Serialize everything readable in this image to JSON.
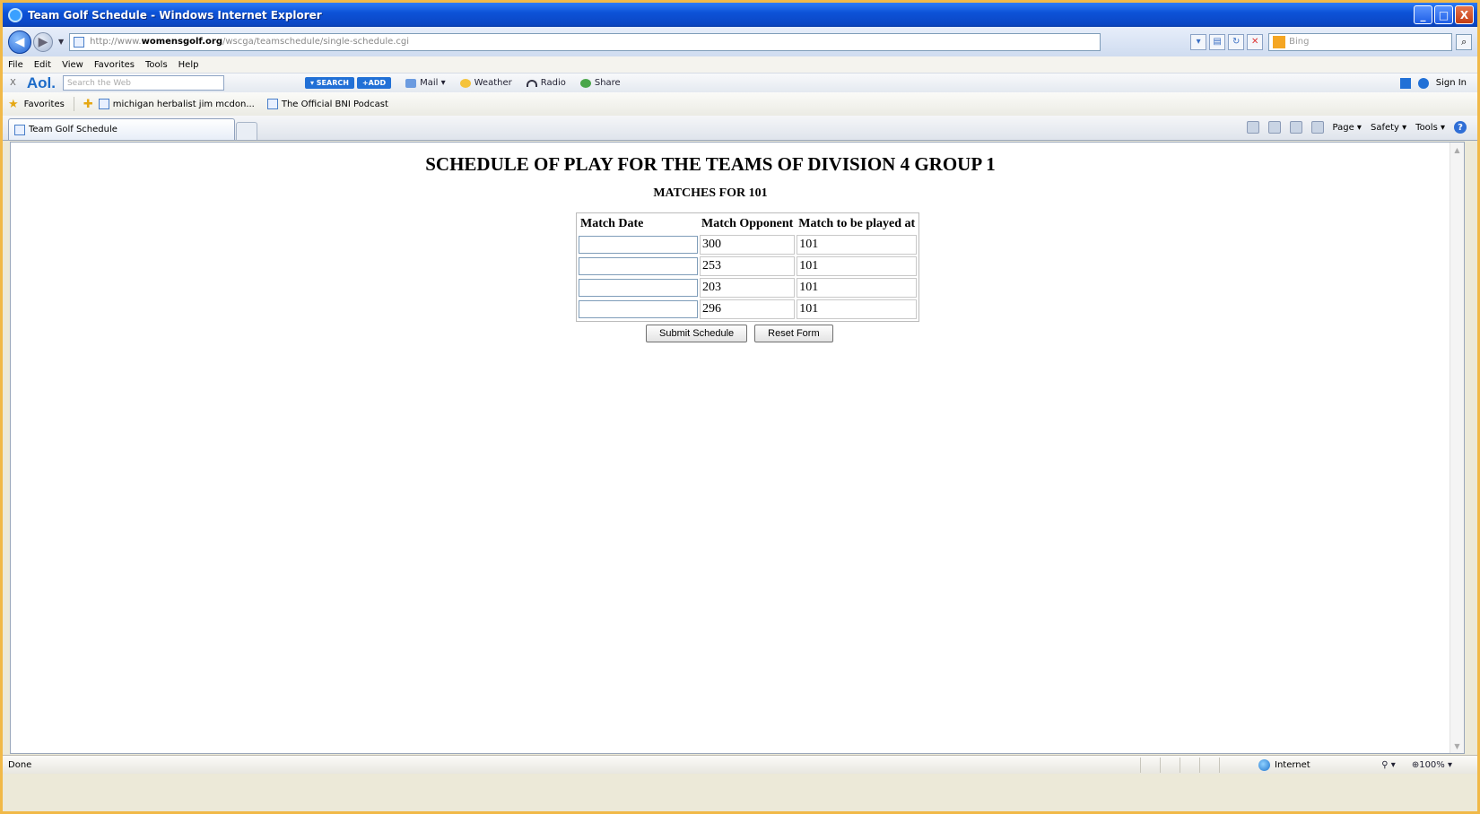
{
  "window": {
    "title": "Team Golf Schedule - Windows Internet Explorer",
    "buttons": [
      "_",
      "□",
      "X"
    ]
  },
  "address": {
    "url_prefix": "http://www.",
    "url_domain": "womensgolf.org",
    "url_path": "/wscga/teamschedule/single-schedule.cgi",
    "search_placeholder": "Bing"
  },
  "menu": [
    "File",
    "Edit",
    "View",
    "Favorites",
    "Tools",
    "Help"
  ],
  "aol": {
    "close": "X",
    "logo": "Aol.",
    "search_placeholder": "Search the Web",
    "search_btn": "▾ SEARCH",
    "plus_btn": "+ADD",
    "links": [
      "Mail ▾",
      "Weather",
      "Radio",
      "Share"
    ],
    "signin": "Sign In"
  },
  "favorites": {
    "label": "Favorites",
    "items": [
      "michigan herbalist jim mcdon...",
      "The Official BNI Podcast"
    ]
  },
  "tab": {
    "title": "Team Golf Schedule"
  },
  "commandbar": [
    "Page ▾",
    "Safety ▾",
    "Tools ▾"
  ],
  "page": {
    "title": "SCHEDULE OF PLAY FOR THE TEAMS OF DIVISION 4 GROUP 1",
    "subtitle": "MATCHES FOR 101",
    "table": {
      "headers": [
        "Match Date",
        "Match Opponent",
        "Match to be played at"
      ],
      "rows": [
        {
          "date": "",
          "opponent": "300",
          "location": "101"
        },
        {
          "date": "",
          "opponent": "253",
          "location": "101"
        },
        {
          "date": "",
          "opponent": "203",
          "location": "101"
        },
        {
          "date": "",
          "opponent": "296",
          "location": "101"
        }
      ]
    },
    "buttons": {
      "submit": "Submit Schedule",
      "reset": "Reset Form"
    }
  },
  "status": {
    "text": "Done",
    "zone": "Internet",
    "zoom": "100%"
  },
  "colors": {
    "titlebar": "#0d53d8",
    "frame": "#f1b948"
  }
}
